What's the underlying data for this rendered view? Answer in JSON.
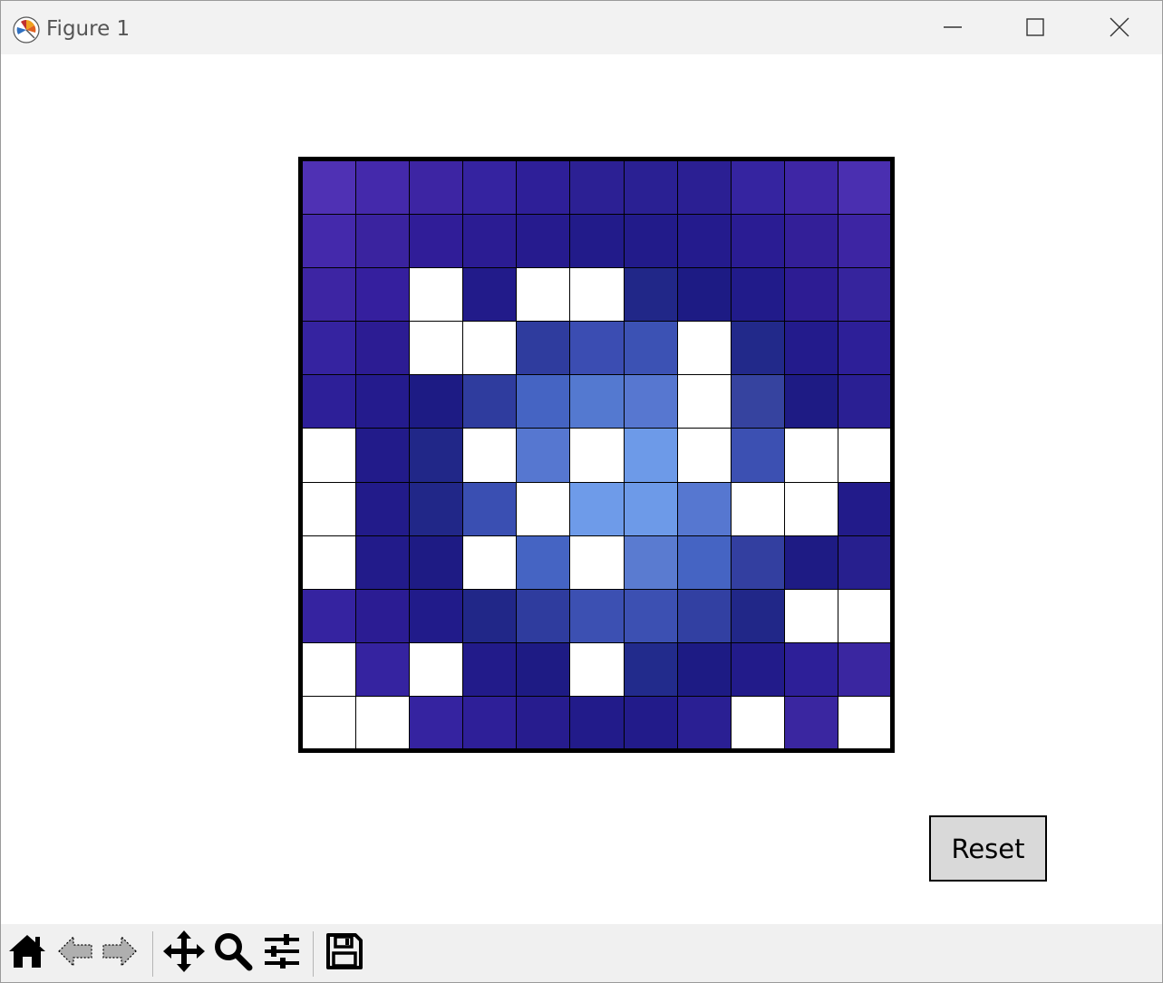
{
  "window": {
    "title": "Figure 1",
    "minimize_icon": "minimize-icon",
    "maximize_icon": "maximize-icon",
    "close_icon": "close-icon"
  },
  "reset_button": {
    "label": "Reset"
  },
  "toolbar": {
    "items": [
      {
        "name": "home-icon",
        "enabled": true
      },
      {
        "name": "back-arrow-icon",
        "enabled": false
      },
      {
        "name": "forward-arrow-icon",
        "enabled": false
      },
      {
        "name": "pan-icon",
        "enabled": true
      },
      {
        "name": "zoom-icon",
        "enabled": true
      },
      {
        "name": "configure-subplots-icon",
        "enabled": true
      },
      {
        "name": "save-icon",
        "enabled": true
      }
    ]
  },
  "grid": {
    "rows": 11,
    "cols": 11,
    "colors": [
      [
        "#4f31b4",
        "#4429ab",
        "#3d25a3",
        "#3523a0",
        "#2e1f98",
        "#2c2094",
        "#2a2093",
        "#2b1f93",
        "#3524a0",
        "#3e26a5",
        "#4a2fb0"
      ],
      [
        "#4429ab",
        "#3a239f",
        "#301d98",
        "#2b1c93",
        "#261b8e",
        "#221b8a",
        "#221b8a",
        "#241b8d",
        "#2a1c93",
        "#331f98",
        "#3d25a3"
      ],
      [
        "#3d25a3",
        "#351f9e",
        "#ffffff",
        "#221b8a",
        "#ffffff",
        "#ffffff",
        "#212788",
        "#1d1b84",
        "#211b8a",
        "#2d1c93",
        "#36249d"
      ],
      [
        "#3523a0",
        "#2c1c93",
        "#ffffff",
        "#ffffff",
        "#2f3c9e",
        "#3b4db2",
        "#3c52b4",
        "#ffffff",
        "#22298a",
        "#231b8c",
        "#2d1f98"
      ],
      [
        "#2d1f98",
        "#241b8d",
        "#1d1b84",
        "#2f3c9e",
        "#4564c3",
        "#5479d0",
        "#5777d0",
        "#ffffff",
        "#36439f",
        "#1e1b84",
        "#2a1f93"
      ],
      [
        "#ffffff",
        "#221b8a",
        "#212788",
        "#ffffff",
        "#5677d0",
        "#ffffff",
        "#6d9ae8",
        "#ffffff",
        "#3c50b2",
        "#ffffff",
        "#ffffff"
      ],
      [
        "#ffffff",
        "#221b8a",
        "#212788",
        "#3a4fb2",
        "#ffffff",
        "#6e9be9",
        "#6d9ae8",
        "#5677d0",
        "#ffffff",
        "#ffffff",
        "#221b8a"
      ],
      [
        "#ffffff",
        "#221b8a",
        "#1e1b84",
        "#ffffff",
        "#4564c3",
        "#ffffff",
        "#5a7bd0",
        "#4564c3",
        "#333fa0",
        "#1e1b84",
        "#271f8e"
      ],
      [
        "#3523a0",
        "#2b1c93",
        "#211b8a",
        "#212788",
        "#2f3c9e",
        "#3c50b2",
        "#3c50b2",
        "#3240a2",
        "#212788",
        "#ffffff",
        "#ffffff"
      ],
      [
        "#ffffff",
        "#3523a0",
        "#ffffff",
        "#221b8a",
        "#1e1b84",
        "#ffffff",
        "#222b8c",
        "#1d1b84",
        "#221b8a",
        "#2d1f98",
        "#3a26a0"
      ],
      [
        "#ffffff",
        "#ffffff",
        "#3523a0",
        "#2e1f98",
        "#271c8e",
        "#221b8a",
        "#221b8a",
        "#2a1f93",
        "#ffffff",
        "#3a26a0",
        "#ffffff"
      ]
    ]
  }
}
